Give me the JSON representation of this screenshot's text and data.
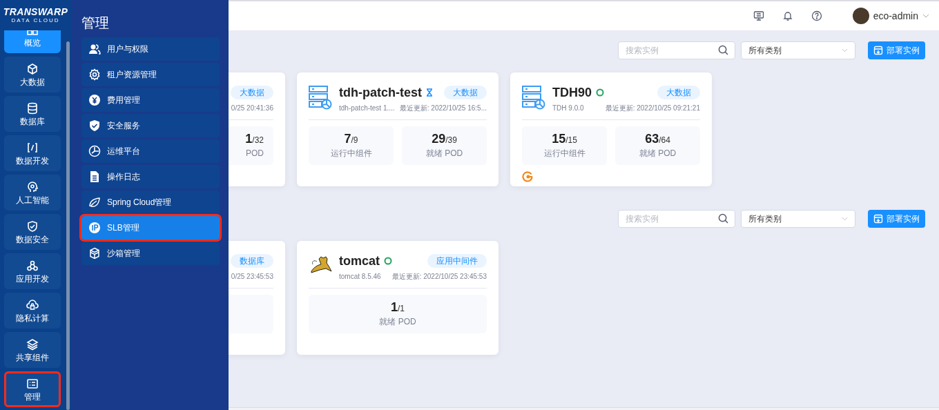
{
  "logo": {
    "brand": "TRANSWARP",
    "tagline": "DATA CLOUD"
  },
  "rail": [
    {
      "label": "概览",
      "selected": true,
      "highlighted": false
    },
    {
      "label": "大数据",
      "selected": false,
      "highlighted": false
    },
    {
      "label": "数据库",
      "selected": false,
      "highlighted": false
    },
    {
      "label": "数据开发",
      "selected": false,
      "highlighted": false
    },
    {
      "label": "人工智能",
      "selected": false,
      "highlighted": false
    },
    {
      "label": "数据安全",
      "selected": false,
      "highlighted": false
    },
    {
      "label": "应用开发",
      "selected": false,
      "highlighted": false
    },
    {
      "label": "隐私计算",
      "selected": false,
      "highlighted": false
    },
    {
      "label": "共享组件",
      "selected": false,
      "highlighted": false
    },
    {
      "label": "管理",
      "selected": false,
      "highlighted": true
    }
  ],
  "menu": {
    "title": "管理",
    "items": [
      {
        "label": "用户与权限",
        "selected": false,
        "highlighted": false
      },
      {
        "label": "租户资源管理",
        "selected": false,
        "highlighted": false
      },
      {
        "label": "费用管理",
        "selected": false,
        "highlighted": false
      },
      {
        "label": "安全服务",
        "selected": false,
        "highlighted": false
      },
      {
        "label": "运维平台",
        "selected": false,
        "highlighted": false
      },
      {
        "label": "操作日志",
        "selected": false,
        "highlighted": false
      },
      {
        "label": "Spring Cloud管理",
        "selected": false,
        "highlighted": false
      },
      {
        "label": "SLB管理",
        "selected": true,
        "highlighted": true
      },
      {
        "label": "沙箱管理",
        "selected": false,
        "highlighted": false
      }
    ]
  },
  "header": {
    "user": "eco-admin"
  },
  "sections": [
    {
      "search": {
        "placeholder": "搜索实例"
      },
      "category": "所有类别",
      "deploy": "部署实例",
      "cards": [
        {
          "kind": "partial",
          "tag": "大数据",
          "updated": "0/25 20:41:36",
          "stats": [
            {
              "value": "1",
              "total": "/32",
              "label": "POD"
            }
          ]
        },
        {
          "kind": "server",
          "title": "tdh-patch-test",
          "pending": true,
          "tag": "大数据",
          "version": "tdh-patch-test 1....",
          "updated": "最近更新: 2022/10/25 16:5...",
          "stats": [
            {
              "value": "7",
              "total": "/9",
              "label": "运行中组件"
            },
            {
              "value": "29",
              "total": "/39",
              "label": "就绪 POD"
            }
          ],
          "extra": false
        },
        {
          "kind": "server",
          "title": "TDH90",
          "pending": false,
          "tag": "大数据",
          "version": "TDH 9.0.0",
          "updated": "最近更新: 2022/10/25 09:21:21",
          "stats": [
            {
              "value": "15",
              "total": "/15",
              "label": "运行中组件"
            },
            {
              "value": "63",
              "total": "/64",
              "label": "就绪 POD"
            }
          ],
          "extra": true
        }
      ]
    },
    {
      "search": {
        "placeholder": "搜索实例"
      },
      "category": "所有类别",
      "deploy": "部署实例",
      "cards": [
        {
          "kind": "partial",
          "tag": "数据库",
          "updated": "0/25 23:45:53"
        },
        {
          "kind": "tomcat",
          "title": "tomcat",
          "pending": false,
          "tag": "应用中间件",
          "version": "tomcat 8.5.46",
          "updated": "最近更新: 2022/10/25 23:45:53",
          "stats": [
            {
              "value": "1",
              "total": "/1",
              "label": "就绪 POD"
            }
          ],
          "extra": false
        }
      ]
    }
  ]
}
